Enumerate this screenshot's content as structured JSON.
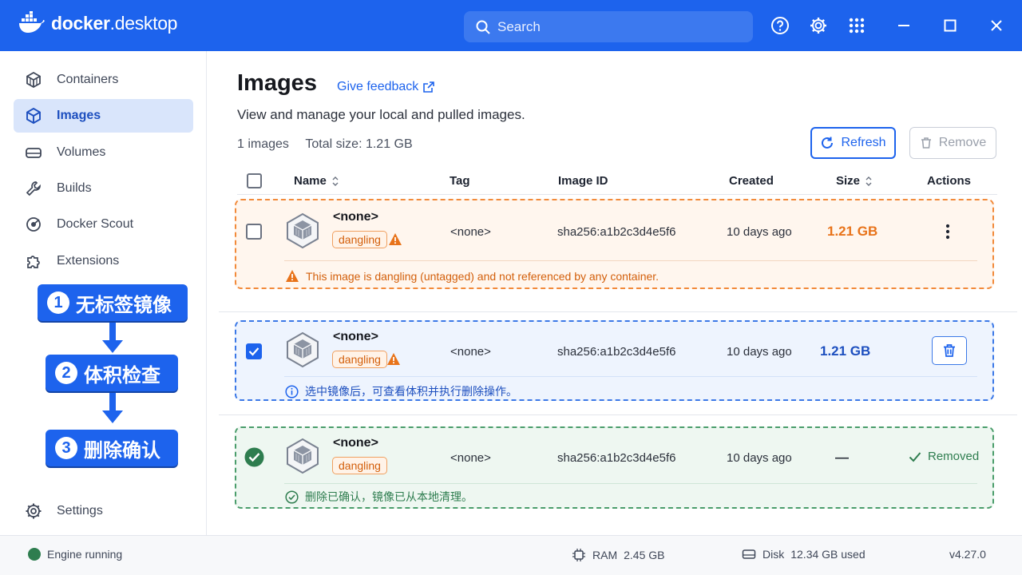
{
  "app": {
    "logo_word1": "docker",
    "logo_word2": ".desktop"
  },
  "search": {
    "placeholder": "Search"
  },
  "sidebar": {
    "items": [
      {
        "label": "Containers",
        "icon": "container-icon"
      },
      {
        "label": "Images",
        "icon": "image-cube-icon",
        "active": true
      },
      {
        "label": "Volumes",
        "icon": "volume-drive-icon"
      },
      {
        "label": "Builds",
        "icon": "wrench-icon"
      },
      {
        "label": "Docker Scout",
        "icon": "scout-icon"
      },
      {
        "label": "Extensions",
        "icon": "puzzle-icon"
      }
    ],
    "settings_label": "Settings"
  },
  "steps": [
    {
      "num": "1",
      "label": "无标签镜像"
    },
    {
      "num": "2",
      "label": "体积检查"
    },
    {
      "num": "3",
      "label": "删除确认"
    }
  ],
  "page": {
    "title": "Images",
    "feedback_label": "Give feedback",
    "subtitle": "View and manage your local and pulled images.",
    "image_count": "1 images",
    "total_size": "Total size: 1.21 GB",
    "refresh_label": "Refresh",
    "remove_label": "Remove"
  },
  "table": {
    "headers": {
      "name": "Name",
      "tag": "Tag",
      "image_id": "Image ID",
      "created": "Created",
      "size": "Size",
      "actions": "Actions"
    },
    "rows": [
      {
        "name": "<none>",
        "badge": "dangling",
        "tag": "<none>",
        "image_id": "sha256:a1b2c3d4e5f6",
        "created": "10 days ago",
        "size": "1.21 GB",
        "checked": false,
        "note": "This image is dangling (untagged) and not referenced by any container."
      },
      {
        "name": "<none>",
        "badge": "dangling",
        "tag": "<none>",
        "image_id": "sha256:a1b2c3d4e5f6",
        "created": "10 days ago",
        "size": "1.21 GB",
        "checked": true,
        "note": "选中镜像后，可查看体积并执行删除操作。"
      },
      {
        "name": "<none>",
        "badge": "dangling",
        "tag": "<none>",
        "image_id": "sha256:a1b2c3d4e5f6",
        "created": "10 days ago",
        "size": "—",
        "action_text": "Removed",
        "note": "删除已确认，镜像已从本地清理。"
      }
    ]
  },
  "status": {
    "engine": "Engine running",
    "ram_label": "RAM",
    "ram_value": "2.45 GB",
    "disk_label": "Disk",
    "disk_value": "12.34 GB used",
    "version": "v4.27.0"
  },
  "colors": {
    "accent": "#1d63ed",
    "warning": "#e8731a",
    "success": "#2e8b57"
  }
}
